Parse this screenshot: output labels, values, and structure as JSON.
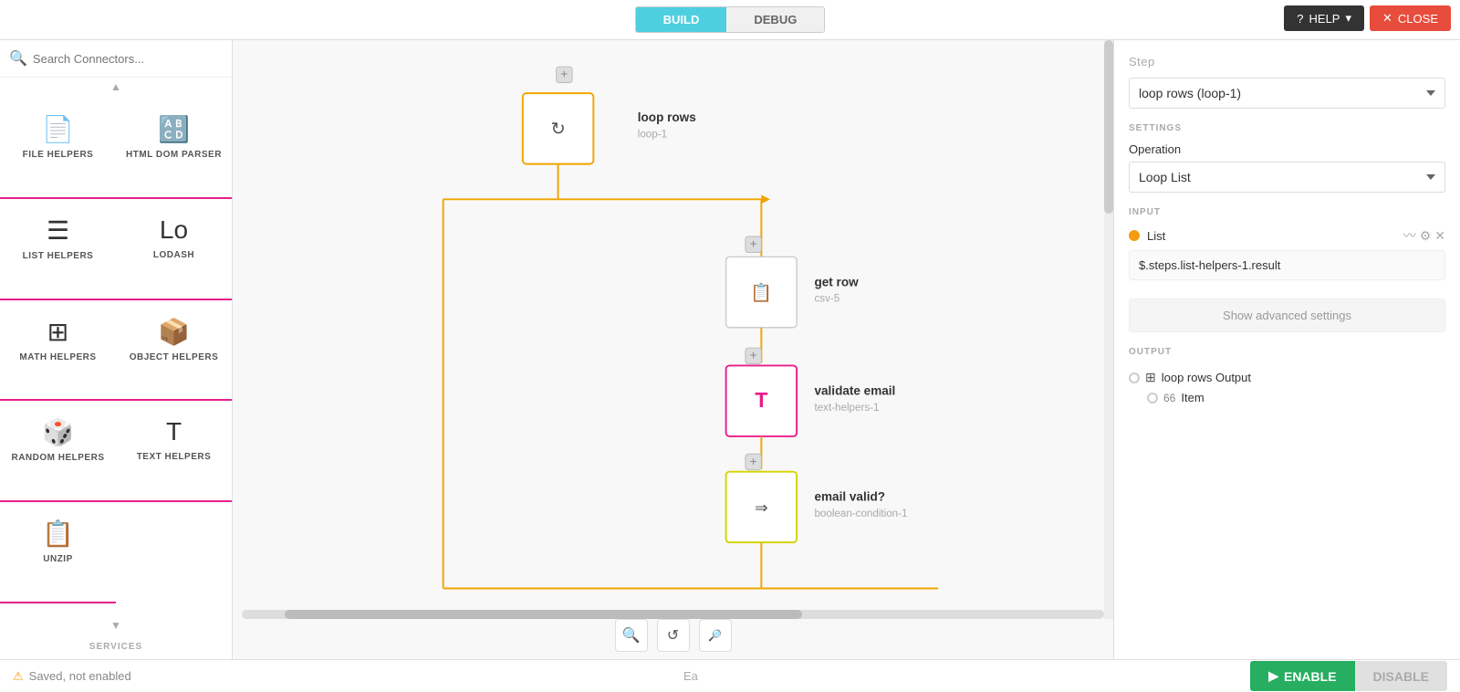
{
  "topbar": {
    "tab_build": "BUILD",
    "tab_debug": "DEBUG",
    "help_label": "HELP",
    "close_label": "CLOSE"
  },
  "sidebar": {
    "search_placeholder": "Search Connectors...",
    "connectors": [
      {
        "id": "file-helpers",
        "label": "FILE HELPERS",
        "icon": "📄"
      },
      {
        "id": "html-dom-parser",
        "label": "HTML DOM PARSER",
        "icon": "🔠"
      },
      {
        "id": "list-helpers",
        "label": "LIST HELPERS",
        "icon": "☰"
      },
      {
        "id": "lodash",
        "label": "LODASH",
        "icon": "Lo"
      },
      {
        "id": "math-helpers",
        "label": "MATH HELPERS",
        "icon": "⊞"
      },
      {
        "id": "object-helpers",
        "label": "OBJECT HELPERS",
        "icon": "📦"
      },
      {
        "id": "random-helpers",
        "label": "RANDOM HELPERS",
        "icon": "🎲"
      },
      {
        "id": "text-helpers",
        "label": "TEXT HELPERS",
        "icon": "T"
      },
      {
        "id": "unzip",
        "label": "UNZIP",
        "icon": "📋"
      }
    ],
    "services_label": "SERVICES"
  },
  "flow": {
    "nodes": [
      {
        "id": "loop-1",
        "label": "loop rows",
        "sublabel": "loop-1",
        "type": "loop"
      },
      {
        "id": "csv-5",
        "label": "get row",
        "sublabel": "csv-5",
        "type": "csv"
      },
      {
        "id": "text-helpers-1",
        "label": "validate email",
        "sublabel": "text-helpers-1",
        "type": "text"
      },
      {
        "id": "boolean-condition-1",
        "label": "email valid?",
        "sublabel": "boolean-condition-1",
        "type": "condition"
      }
    ]
  },
  "right_panel": {
    "step_title": "Step",
    "step_value": "loop rows (loop-1)",
    "settings_label": "SETTINGS",
    "operation_label": "Operation",
    "operation_value": "Loop List",
    "input_label": "INPUT",
    "list_label": "List",
    "list_value": "$.steps.list-helpers-1.result",
    "advanced_settings_label": "Show advanced settings",
    "output_label": "OUTPUT",
    "output_row_label": "loop rows Output",
    "output_sub_num": "66",
    "output_sub_label": "Item"
  },
  "statusbar": {
    "status_text": "Saved, not enabled",
    "enable_label": "ENABLE",
    "disable_label": "DISABLE",
    "bottom_text": "Ea"
  },
  "canvas": {
    "zoom_in_icon": "🔍",
    "refresh_icon": "↺",
    "zoom_out_icon": "🔎"
  }
}
